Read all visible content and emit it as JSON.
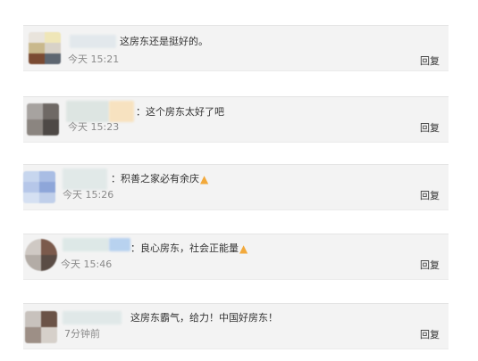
{
  "reply_label": "回复",
  "comments": [
    {
      "text": "这房东还是挺好的。",
      "time": "今天 15:21",
      "emoji": ""
    },
    {
      "text": "：这个房东太好了吧",
      "time": "今天 15:23",
      "emoji": ""
    },
    {
      "text": "：积善之家必有余庆",
      "time": "今天 15:26",
      "emoji": "thumbs-up-icon"
    },
    {
      "text": "：良心房东，社会正能量",
      "time": "今天 15:46",
      "emoji": "thumbs-up-icon"
    },
    {
      "text": "这房东霸气，给力！中国好房东！",
      "time": "7分钟前",
      "emoji": ""
    }
  ],
  "colors": {
    "card_bg": "#f3f3f3",
    "emoji": "#f2a93b"
  }
}
